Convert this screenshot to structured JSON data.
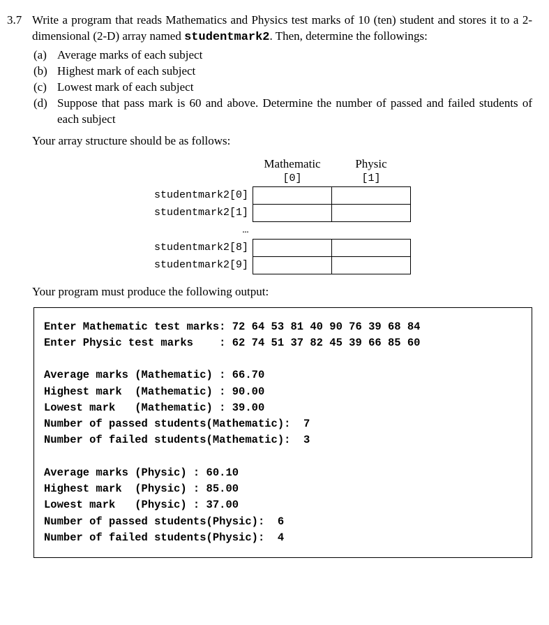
{
  "problem_number": "3.7",
  "stem_part1": "Write a program that reads Mathematics and Physics test marks of 10 (ten) student and stores it to a 2-dimensional (2-D) array named ",
  "stem_code": "studentmark2",
  "stem_part2": ". Then, determine the followings:",
  "subs": {
    "a": {
      "label": "(a)",
      "text": "Average marks of each subject"
    },
    "b": {
      "label": "(b)",
      "text": "Highest mark of each subject"
    },
    "c": {
      "label": "(c)",
      "text": "Lowest mark of each subject"
    },
    "d": {
      "label": "(d)",
      "text": "Suppose that pass mark is 60 and above. Determine the number of passed and failed students of each subject"
    }
  },
  "array_intro": "Your array structure should be as follows:",
  "array": {
    "col0_name": "Mathematic",
    "col0_idx": "[0]",
    "col1_name": "Physic",
    "col1_idx": "[1]",
    "rows": {
      "r0": "studentmark2[0]",
      "r1": "studentmark2[1]",
      "gap": "…",
      "r8": "studentmark2[8]",
      "r9": "studentmark2[9]"
    }
  },
  "output_intro": "Your program must produce the following output:",
  "output": {
    "line1": "Enter Mathematic test marks: 72 64 53 81 40 90 76 39 68 84",
    "line2": "Enter Physic test marks    : 62 74 51 37 82 45 39 66 85 60",
    "blank1": "",
    "line3": "Average marks (Mathematic) : 66.70",
    "line4": "Highest mark  (Mathematic) : 90.00",
    "line5": "Lowest mark   (Mathematic) : 39.00",
    "line6": "Number of passed students(Mathematic):  7",
    "line7": "Number of failed students(Mathematic):  3",
    "blank2": "",
    "line8": "Average marks (Physic) : 60.10",
    "line9": "Highest mark  (Physic) : 85.00",
    "line10": "Lowest mark   (Physic) : 37.00",
    "line11": "Number of passed students(Physic):  6",
    "line12": "Number of failed students(Physic):  4"
  }
}
